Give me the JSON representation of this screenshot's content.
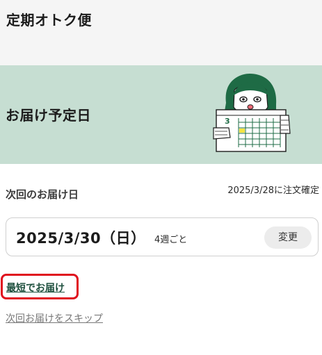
{
  "header": {
    "title": "定期オトク便"
  },
  "banner": {
    "heading": "お届け予定日",
    "illustration_icon": "person-holding-calendar-icon",
    "illustration_calendar_month": "3"
  },
  "delivery": {
    "next_label": "次回のお届け日",
    "order_confirmation": "2025/3/28に注文確定",
    "date": "2025/3/30（日）",
    "frequency": "4週ごと",
    "change_button": "変更"
  },
  "links": {
    "earliest": "最短でお届け",
    "skip": "次回お届けをスキップ"
  },
  "colors": {
    "banner_bg": "#c6ded2",
    "highlight_border": "#e0101e",
    "link_green": "#1d4f3d",
    "illustration_green": "#1e6b45"
  }
}
